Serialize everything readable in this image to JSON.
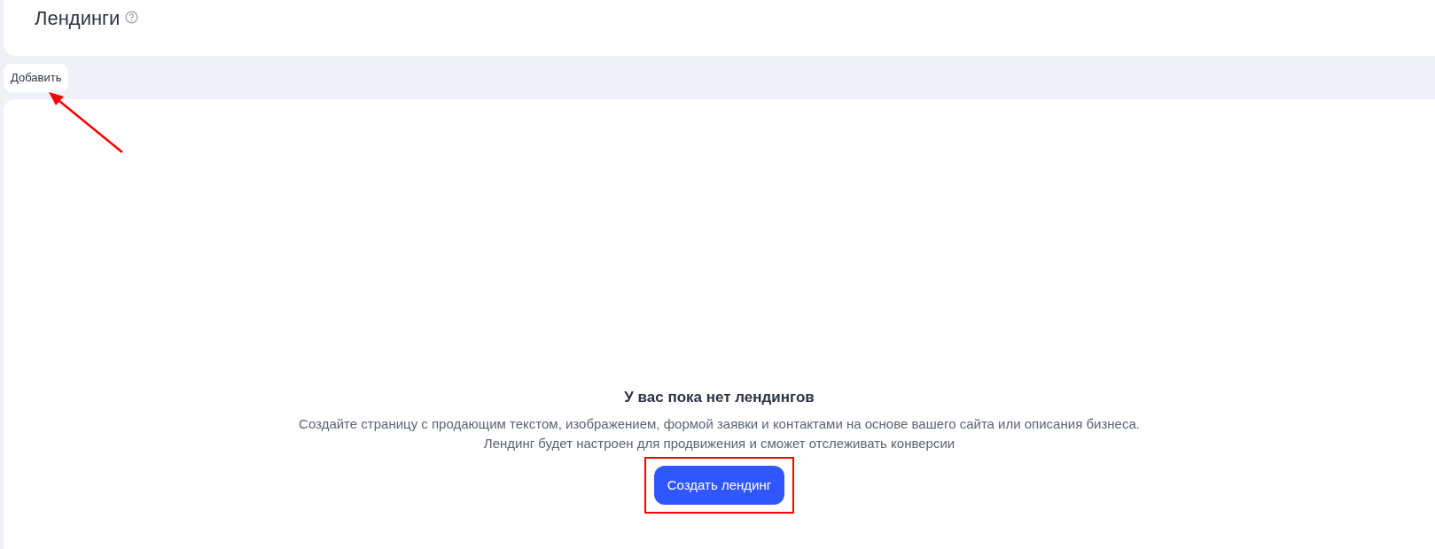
{
  "header": {
    "title": "Лендинги"
  },
  "toolbar": {
    "add_button": "Добавить"
  },
  "empty_state": {
    "heading": "У вас пока нет лендингов",
    "description_lines": [
      "Создайте страницу с продающим текстом, изображением, формой заявки и контактами на основе вашего сайта или описания бизнеса.",
      "Лендинг будет настроен для продвижения и сможет отслеживать конверсии"
    ],
    "button": "Создать лендинг"
  }
}
